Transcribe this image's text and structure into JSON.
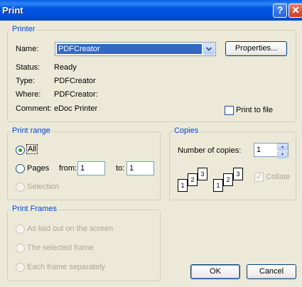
{
  "window": {
    "title": "Print",
    "help_glyph": "?",
    "close_glyph": "✕"
  },
  "printer": {
    "legend": "Printer",
    "name_label": "Name:",
    "name_value": "PDFCreator",
    "properties_label": "Properties...",
    "status_label": "Status:",
    "status_value": "Ready",
    "type_label": "Type:",
    "type_value": "PDFCreator",
    "where_label": "Where:",
    "where_value": "PDFCreator:",
    "comment_label": "Comment:",
    "comment_value": "eDoc Printer",
    "print_to_file_label": "Print to file"
  },
  "print_range": {
    "legend": "Print range",
    "all_label": "All",
    "pages_label": "Pages",
    "from_label": "from:",
    "from_value": "1",
    "to_label": "to:",
    "to_value": "1",
    "selection_label": "Selection"
  },
  "copies": {
    "legend": "Copies",
    "number_label": "Number of copies:",
    "number_value": "1",
    "collate_label": "Collate",
    "page_numbers": [
      "1",
      "2",
      "3"
    ]
  },
  "print_frames": {
    "legend": "Print Frames",
    "options": [
      "As laid out on the screen",
      "The selected frame",
      "Each frame separately"
    ]
  },
  "buttons": {
    "ok": "OK",
    "cancel": "Cancel"
  },
  "colors": {
    "title_bar": "#0054E3",
    "dialog_bg": "#ECE9D8",
    "legend_text": "#0046D5",
    "selection": "#316AC5"
  }
}
